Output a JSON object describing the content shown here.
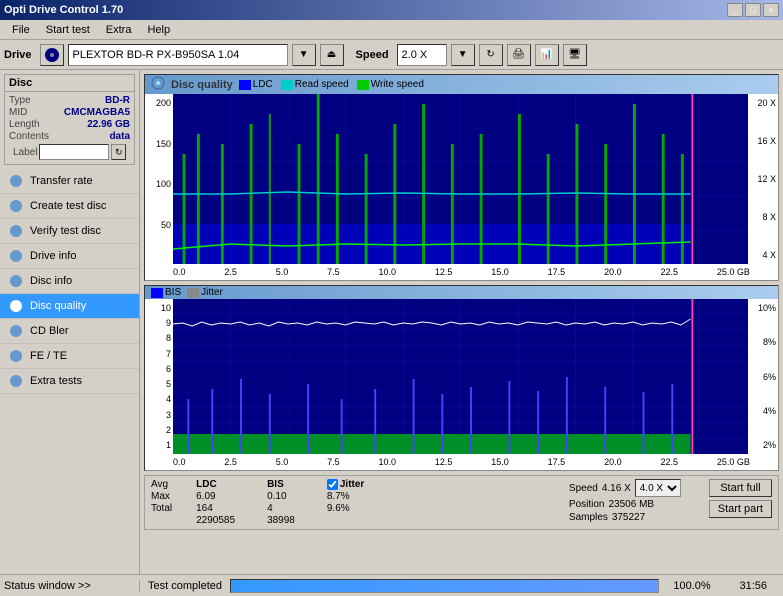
{
  "window": {
    "title": "Opti Drive Control 1.70",
    "title_buttons": [
      "_",
      "□",
      "×"
    ]
  },
  "menu": {
    "items": [
      "File",
      "Start test",
      "Extra",
      "Help"
    ]
  },
  "toolbar": {
    "drive_label": "Drive",
    "drive_icon": "💿",
    "drive_name": "PLEXTOR BD-R PX-B950SA 1.04",
    "speed_label": "Speed",
    "speed_value": "2.0 X"
  },
  "disc": {
    "header": "Disc",
    "fields": [
      {
        "key": "Type",
        "value": "BD-R"
      },
      {
        "key": "MID",
        "value": "CMCMAGBA5"
      },
      {
        "key": "Length",
        "value": "22.96 GB"
      },
      {
        "key": "Contents",
        "value": "data"
      },
      {
        "key": "Label",
        "value": ""
      }
    ]
  },
  "nav": {
    "items": [
      {
        "label": "Transfer rate",
        "icon": "📈",
        "active": false
      },
      {
        "label": "Create test disc",
        "icon": "💿",
        "active": false
      },
      {
        "label": "Verify test disc",
        "icon": "✓",
        "active": false
      },
      {
        "label": "Drive info",
        "icon": "ℹ",
        "active": false
      },
      {
        "label": "Disc info",
        "icon": "💿",
        "active": false
      },
      {
        "label": "Disc quality",
        "icon": "★",
        "active": true
      },
      {
        "label": "CD Bler",
        "icon": "📊",
        "active": false
      },
      {
        "label": "FE / TE",
        "icon": "📉",
        "active": false
      },
      {
        "label": "Extra tests",
        "icon": "🔧",
        "active": false
      }
    ]
  },
  "chart": {
    "title": "Disc quality",
    "legend": [
      "LDC",
      "Read speed",
      "Write speed"
    ],
    "upper": {
      "y_left": [
        "200",
        "150",
        "100",
        "50"
      ],
      "y_right": [
        "20 X",
        "16 X",
        "12 X",
        "8 X",
        "4 X"
      ],
      "x_labels": [
        "0.0",
        "2.5",
        "5.0",
        "7.5",
        "10.0",
        "12.5",
        "15.0",
        "17.5",
        "20.0",
        "22.5",
        "25.0 GB"
      ]
    },
    "lower": {
      "title2": "BIS",
      "title3": "Jitter",
      "y_left": [
        "10",
        "9",
        "8",
        "7",
        "6",
        "5",
        "4",
        "3",
        "2",
        "1"
      ],
      "y_right": [
        "10%",
        "8%",
        "6%",
        "4%",
        "2%"
      ],
      "x_labels": [
        "0.0",
        "2.5",
        "5.0",
        "7.5",
        "10.0",
        "12.5",
        "15.0",
        "17.5",
        "20.0",
        "22.5",
        "25.0 GB"
      ]
    }
  },
  "stats": {
    "avg_label": "Avg",
    "max_label": "Max",
    "total_label": "Total",
    "ldc_avg": "6.09",
    "ldc_max": "164",
    "ldc_total": "2290585",
    "bis_avg": "0.10",
    "bis_max": "4",
    "bis_total": "38998",
    "jitter_avg": "8.7%",
    "jitter_max": "9.6%",
    "jitter_label": "Jitter",
    "speed_label": "Speed",
    "speed_value": "4.16 X",
    "speed_dropdown": "4.0 X",
    "position_label": "Position",
    "position_value": "23506 MB",
    "samples_label": "Samples",
    "samples_value": "375227",
    "start_full": "Start full",
    "start_part": "Start part"
  },
  "status": {
    "window_btn": "Status window >>",
    "progress": "100.0%",
    "time": "31:56",
    "completed": "Test completed"
  }
}
